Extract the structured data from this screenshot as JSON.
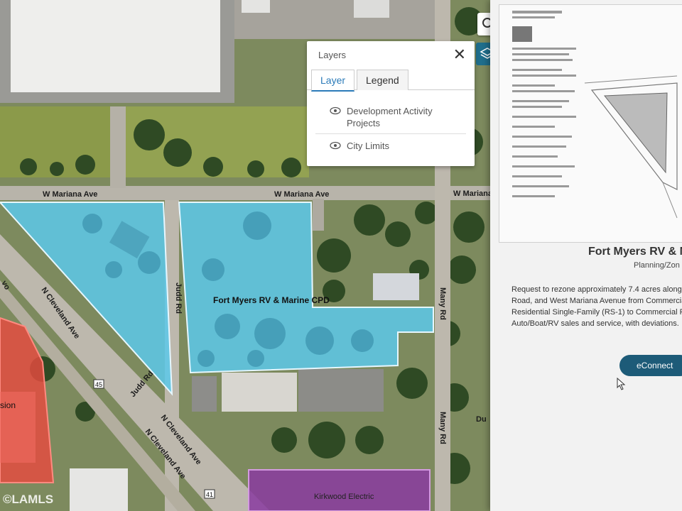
{
  "map": {
    "streets": {
      "mariana_west": "W Mariana Ave",
      "mariana_mid": "W Mariana Ave",
      "mariana_east": "W Mariana",
      "judd_upper": "Judd Rd",
      "judd_lower": "Judd Rd",
      "cleveland_upper": "N Cleveland Ave",
      "cleveland_lower_a": "N Cleveland Ave",
      "cleveland_lower_b": "N Cleveland Ave",
      "many_upper": "Many Rd",
      "many_lower": "Many Rd",
      "route_45": "45",
      "route_41": "41",
      "fragment_left": "vo",
      "fragment_right": "Du"
    },
    "parcels": {
      "main_label": "Fort Myers RV & Marine CPD",
      "bottom_label": "Kirkwood Electric",
      "left_label": "sion"
    },
    "colors": {
      "cpd_fill": "#5cc8ea",
      "left_fill": "#e84a40",
      "bottom_fill": "#8a3aa0"
    }
  },
  "layers_panel": {
    "title": "Layers",
    "close_icon": "close-icon",
    "tabs": [
      "Layer",
      "Legend"
    ],
    "active_tab": "Layer",
    "items": [
      {
        "line1": "Development Activity",
        "line2": "Projects",
        "icon": "eye-icon"
      },
      {
        "line1": "City Limits",
        "icon": "eye-icon"
      }
    ]
  },
  "toolbar": {
    "search_icon": "search-icon",
    "layers_icon": "layers-icon"
  },
  "sidebar": {
    "title": "Fort Myers RV & M",
    "subtitle": "Planning/Zon",
    "description": [
      "Request to rezone approximately 7.4 acres along",
      "Road, and West Mariana Avenue from Commercia",
      "Residential Single-Family (RS-1) to Commercial Pl",
      "Auto/Boat/RV sales and service, with deviations."
    ],
    "button_label": "eConnect"
  },
  "watermark": "©LAMLS"
}
